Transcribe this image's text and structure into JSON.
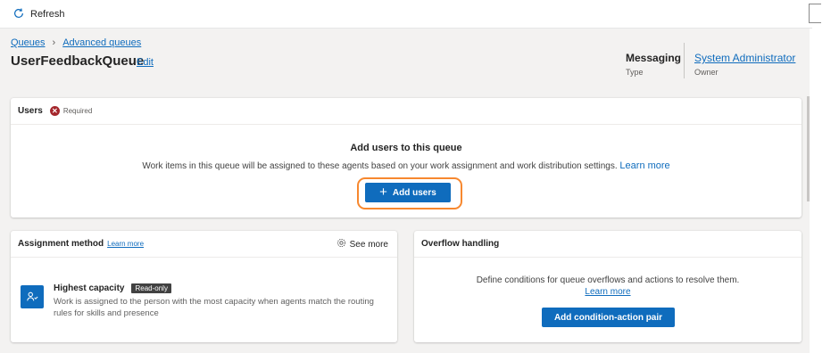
{
  "toolbar": {
    "refresh_label": "Refresh",
    "refresh_icon": "refresh-icon"
  },
  "breadcrumb": {
    "items": [
      "Queues",
      "Advanced queues"
    ],
    "separator": ">"
  },
  "queue": {
    "name": "UserFeedbackQueue",
    "edit_label": "Edit"
  },
  "meta": {
    "type_value": "Messaging",
    "type_label": "Type",
    "owner_value": "System Administrator",
    "owner_label": "Owner"
  },
  "users_card": {
    "title": "Users",
    "required_label": "Required",
    "heading": "Add users to this queue",
    "description": "Work items in this queue will be assigned to these agents based on your work assignment and work distribution settings.",
    "learn_more": "Learn more",
    "add_button": "Add users"
  },
  "assignment_card": {
    "title": "Assignment method",
    "learn_more": "Learn more",
    "see_more": "See more",
    "method_title": "Highest capacity",
    "badge": "Read-only",
    "method_desc": "Work is assigned to the person with the most capacity when agents match the routing rules for skills and presence"
  },
  "overflow_card": {
    "title": "Overflow handling",
    "description": "Define conditions for queue overflows and actions to resolve them.",
    "learn_more": "Learn more",
    "button": "Add condition-action pair"
  },
  "colors": {
    "accent": "#0f6cbd",
    "highlight": "#f7882f",
    "required": "#a4262c",
    "background": "#f3f2f1"
  }
}
